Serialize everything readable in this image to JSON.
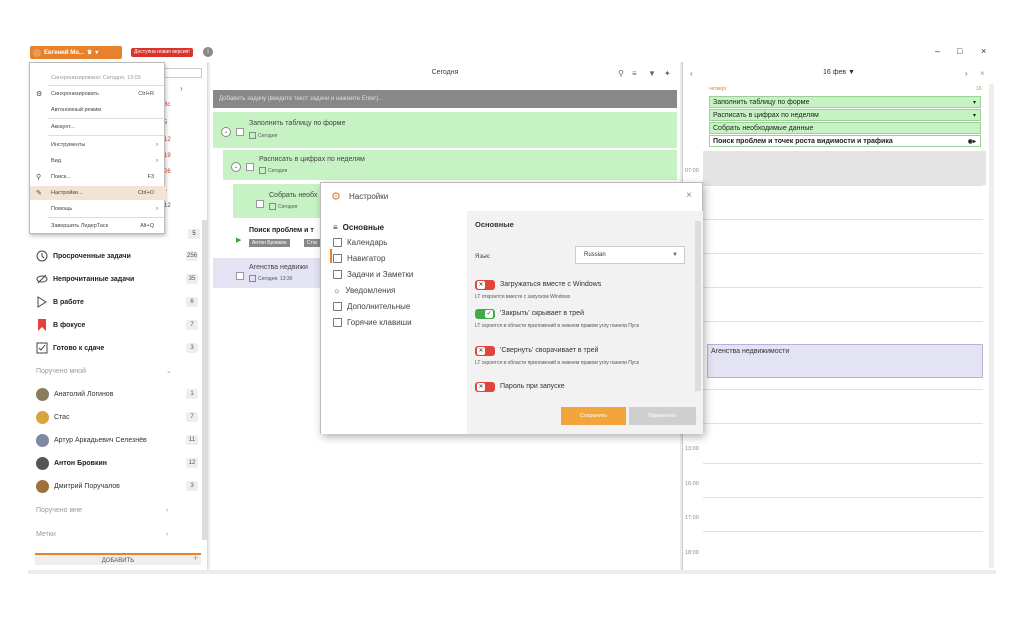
{
  "titlebar": {
    "user": "Евгений Мо...",
    "new_version": "Доступна новая версия!",
    "minimize": "–",
    "maximize": "□",
    "close": "×"
  },
  "menu": {
    "sync_status": "Синхронизировано: Сегодня, 13:03",
    "items": [
      {
        "label": "Синхронизировать",
        "shortcut": "Ctrl+R"
      },
      {
        "label": "Автономный режим",
        "shortcut": ""
      },
      {
        "label": "Аккаунт...",
        "shortcut": ""
      },
      {
        "label": "Инструменты",
        "shortcut": ""
      },
      {
        "label": "Вид",
        "shortcut": ""
      },
      {
        "label": "Поиск...",
        "shortcut": "F3"
      },
      {
        "label": "Настройки...",
        "shortcut": "Ctrl+O"
      },
      {
        "label": "Помощь",
        "shortcut": ""
      },
      {
        "label": "Завершить ЛидерТаск",
        "shortcut": "Alt+Q"
      }
    ]
  },
  "sidebar": {
    "hidden_counts": [
      "8с",
      "5",
      "12",
      "19",
      "26",
      "1",
      "12",
      "5"
    ],
    "items": [
      {
        "label": "Просроченные задачи",
        "count": "256",
        "bold": true
      },
      {
        "label": "Непрочитанные задачи",
        "count": "35",
        "bold": true
      },
      {
        "label": "В работе",
        "count": "6",
        "bold": true
      },
      {
        "label": "В фокусе",
        "count": "7",
        "bold": true
      },
      {
        "label": "Готово к сдаче",
        "count": "3",
        "bold": true
      }
    ],
    "section_assigned_by_me": "Поручено мной",
    "people": [
      {
        "label": "Анатолий Логинов",
        "count": "1"
      },
      {
        "label": "Стас",
        "count": "7"
      },
      {
        "label": "Артур Аркадьевич Селезнёв",
        "count": "11"
      },
      {
        "label": "Антон Бровкин",
        "count": "12"
      },
      {
        "label": "Дмитрий Поручалов",
        "count": "3"
      }
    ],
    "section_assigned_to_me": "Поручено мне",
    "section_tags": "Метки",
    "add_button": "ДОБАВИТЬ",
    "add_plus": "+"
  },
  "middle": {
    "title": "Сегодня",
    "add_task_placeholder": "Добавить задачу (введите текст задачи и нажмите Enter)...",
    "tasks": [
      {
        "title": "Заполнить таблицу по форме",
        "date": "Сегодня"
      },
      {
        "title": "Расписать в цифрах по неделям",
        "date": "Сегодня"
      },
      {
        "title": "Собрать необх",
        "date": "Сегодня"
      },
      {
        "title": "Поиск проблем и т",
        "tag1": "Антон Бровкин",
        "tag2": "Стаг"
      },
      {
        "title": "Агенства недвижи",
        "date": "Сегодня, 13:30"
      }
    ]
  },
  "calendar": {
    "date": "16 фев ▼",
    "weekday": "четверг",
    "day_num": "16",
    "events": [
      "Заполнить таблицу по форме",
      "Расписать в цифрах по неделям",
      "Собрать необходимые данные",
      "Поиск проблем и точек роста видимости и трафика"
    ],
    "hours": [
      "07:00",
      "13:00",
      "16:00",
      "17:00",
      "18:00"
    ],
    "block_event": "Агенства недвижимости"
  },
  "settings": {
    "title": "Настройки",
    "nav": [
      "Основные",
      "Календарь",
      "Навигатор",
      "Задачи и Заметки",
      "Уведомления",
      "Дополнительные",
      "Горячие клавиши"
    ],
    "panel_title": "Основные",
    "lang_label": "Язык:",
    "lang_value": "Russian",
    "toggles": [
      {
        "label": "Загружаться вместе с Windows",
        "sub": "LT откроется вместе с запуском Windows",
        "on": false
      },
      {
        "label": "'Закрыть' скрывает в трей",
        "sub": "LT скроется в области приложений в нижнем правом углу панели Пуск",
        "on": true
      },
      {
        "label": "'Свернуть' сворачивает в трей",
        "sub": "LT скроется в области приложений в нижнем правом углу панели Пуск",
        "on": false
      },
      {
        "label": "Пароль при запуске",
        "sub": "",
        "on": false
      }
    ],
    "save": "Сохранить",
    "apply": "Применить"
  },
  "colors": {
    "accent": "#e8812b",
    "task_green": "#c7f3c4",
    "toggle_off": "#e0443a",
    "toggle_on": "#3fab4a"
  }
}
